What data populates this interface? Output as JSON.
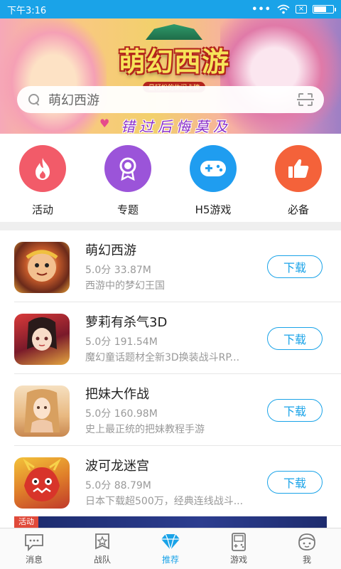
{
  "status_bar": {
    "time": "下午3:16",
    "signal": "•••"
  },
  "banner": {
    "logo_text": "萌幻西游",
    "logo_subtitle": "最轻松的休闲卡牌",
    "slogan": "错过后悔莫及"
  },
  "search": {
    "placeholder": "萌幻西游"
  },
  "categories": [
    {
      "label": "活动",
      "icon": "flame-icon",
      "color": "#f25b69"
    },
    {
      "label": "专题",
      "icon": "badge-icon",
      "color": "#9b54d9"
    },
    {
      "label": "H5游戏",
      "icon": "gamepad-icon",
      "color": "#1f9df0"
    },
    {
      "label": "必备",
      "icon": "thumbs-up-icon",
      "color": "#f4623a"
    }
  ],
  "apps": [
    {
      "name": "萌幻西游",
      "meta": "5.0分 33.87M",
      "desc": "西游中的梦幻王国",
      "button": "下载"
    },
    {
      "name": "萝莉有杀气3D",
      "meta": "5.0分 191.54M",
      "desc": "魔幻童话题材全新3D换装战斗RP...",
      "button": "下载"
    },
    {
      "name": "把妹大作战",
      "meta": "5.0分 160.98M",
      "desc": "史上最正统的把妹教程手游",
      "button": "下载"
    },
    {
      "name": "波可龙迷宫",
      "meta": "5.0分 88.79M",
      "desc": "日本下载超500万，经典连线战斗...",
      "button": "下载"
    }
  ],
  "activity_tag": "活动",
  "tabs": [
    {
      "label": "消息",
      "icon": "message-icon"
    },
    {
      "label": "战队",
      "icon": "team-icon"
    },
    {
      "label": "推荐",
      "icon": "diamond-icon",
      "active": true
    },
    {
      "label": "游戏",
      "icon": "gameboy-icon"
    },
    {
      "label": "我",
      "icon": "face-icon"
    }
  ],
  "colors": {
    "accent": "#1aa3e8",
    "divider": "#efefef"
  }
}
